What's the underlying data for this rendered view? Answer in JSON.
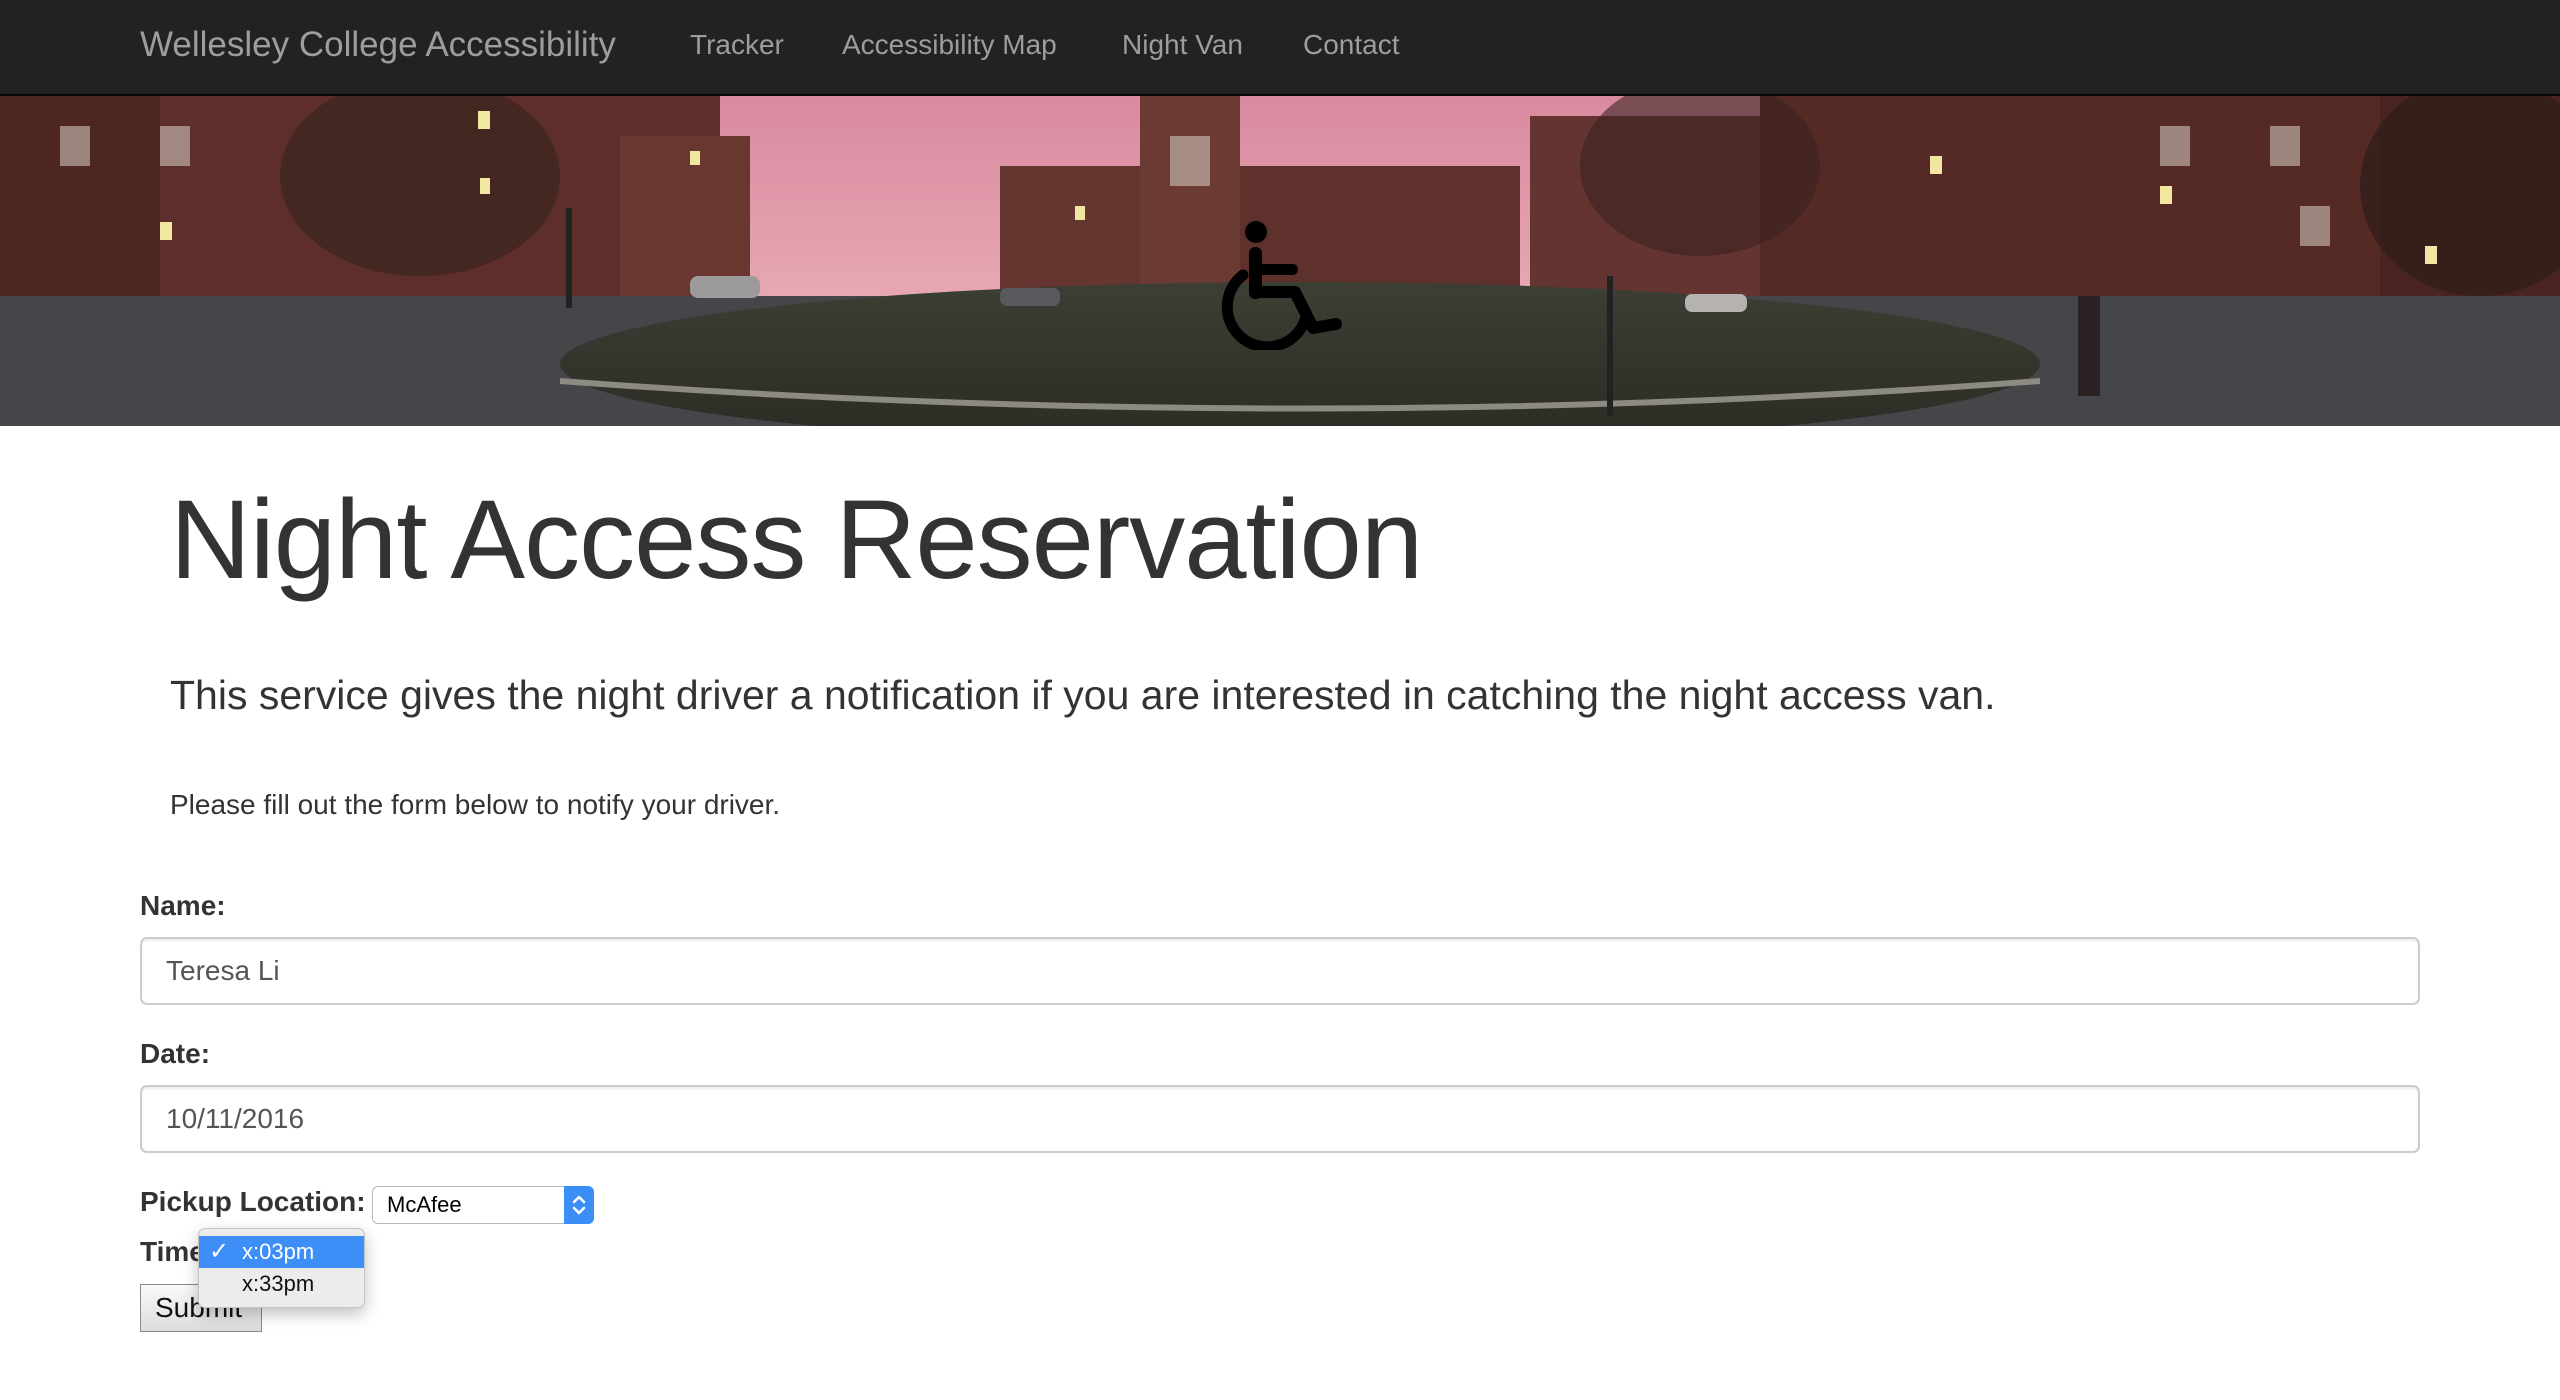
{
  "navbar": {
    "brand": "Wellesley College Accessibility",
    "items": [
      {
        "label": "Tracker"
      },
      {
        "label": "Accessibility Map"
      },
      {
        "label": "Night Van"
      },
      {
        "label": "Contact"
      }
    ]
  },
  "hero": {
    "icon": "wheelchair-icon"
  },
  "page": {
    "title": "Night Access Reservation",
    "lead": "This service gives the night driver a notification if you are interested in catching the night access van.",
    "instructions": "Please fill out the form below to notify your driver."
  },
  "form": {
    "name_label": "Name:",
    "name_value": "Teresa Li",
    "date_label": "Date:",
    "date_value": "10/11/2016",
    "pickup_label": "Pickup Location:",
    "pickup_value": "McAfee",
    "time_label": "Time",
    "submit_label": "Submit",
    "time_options": [
      {
        "label": "x:03pm",
        "selected": true
      },
      {
        "label": "x:33pm",
        "selected": false
      }
    ],
    "check_glyph": "✓"
  },
  "colors": {
    "navbar_bg": "#222222",
    "nav_text": "#9d9d9d",
    "selection": "#3d8ef6"
  }
}
